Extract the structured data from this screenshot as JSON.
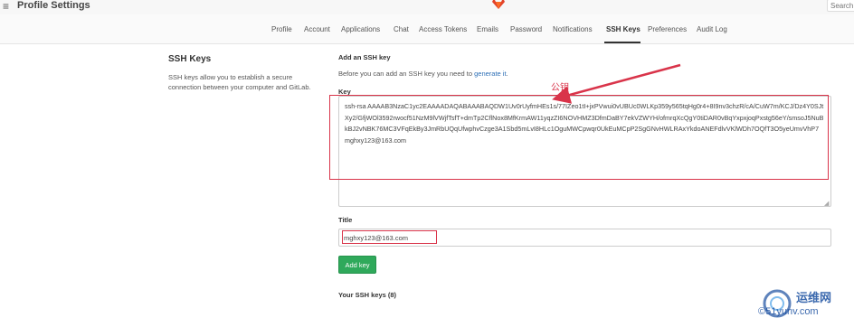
{
  "header": {
    "menu_icon": "hamburger-icon",
    "title": "Profile Settings",
    "logo_icon": "gitlab-fox-logo",
    "search_placeholder": "Search"
  },
  "tabs": [
    {
      "label": "Profile"
    },
    {
      "label": "Account"
    },
    {
      "label": "Applications"
    },
    {
      "label": "Chat"
    },
    {
      "label": "Access Tokens"
    },
    {
      "label": "Emails"
    },
    {
      "label": "Password"
    },
    {
      "label": "Notifications"
    },
    {
      "label": "SSH Keys",
      "active": true
    },
    {
      "label": "Preferences"
    },
    {
      "label": "Audit Log"
    }
  ],
  "sidebar": {
    "title": "SSH Keys",
    "description": "SSH keys allow you to establish a secure connection between your computer and GitLab."
  },
  "form": {
    "section_title": "Add an SSH key",
    "intro_text": "Before you can add an SSH key you need to ",
    "intro_link": "generate it",
    "intro_end": ".",
    "key_label": "Key",
    "key_value": "ssh-rsa AAAAB3NzaC1yc2EAAAADAQABAAABAQDW1Uv0rUyfmHEs1s/77IZeo1tI+jxPVwui0vUBUc0WLKp359y565tqHg0r4+8I9nv3chzR/cA/CuW7m/KCJ/Dz4Y0SJtXy2/GfjWOl3592rwocf51NzM9lVWjfTsfT+dmTp2CflNox8MfKrmAW11yqzZI6NOVHMZ3DfmDaBY7ekVZWYH/ofmrqXcQgY0tiDAR0vBqYxpxjoqPxstg56eY/smsoJ5NuBkBJ2vNBK76MC3VFqEkBy3JmRbUQqUfwphvCzge3A1Sbd5mLvI8HLc1OguMWCpwqr0UkEuMCpP2SgGNvHWLRAxYkdoANEFdlvVKlWDh7OQfT3O5yeUmvVhP7 mghxy123@163.com",
    "title_label": "Title",
    "title_value": "mghxy123@163.com",
    "add_button": "Add key",
    "keys_heading": "Your SSH keys (8)"
  },
  "annotation": {
    "label": "公钥",
    "color": "#d9344a"
  },
  "watermark": {
    "text": "运维网",
    "sub": "©51yunv.com"
  },
  "colors": {
    "accent": "#2fa95b",
    "link": "#2d6fb6",
    "annotation": "#d9344a"
  }
}
